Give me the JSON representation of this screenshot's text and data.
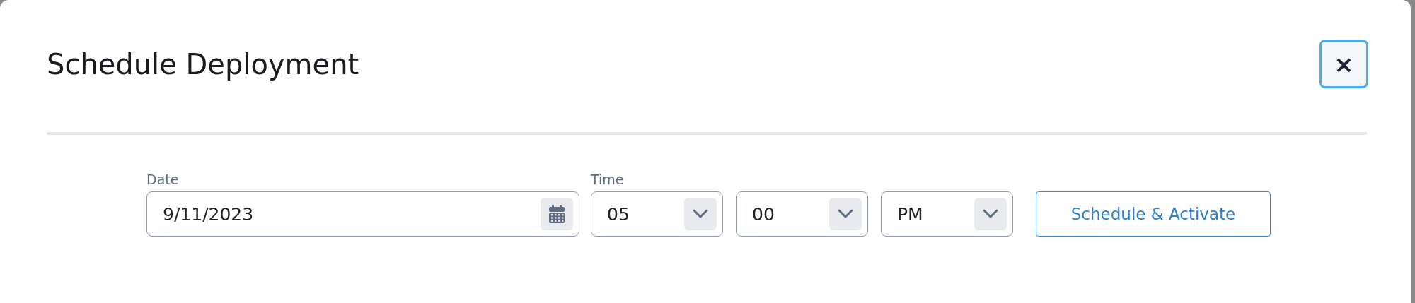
{
  "dialog": {
    "title": "Schedule Deployment",
    "close_button": {
      "label": "×",
      "focused": true
    }
  },
  "form": {
    "date": {
      "label": "Date",
      "value": "9/11/2023"
    },
    "time": {
      "label": "Time",
      "selects": [
        {
          "value": "05"
        },
        {
          "value": "00"
        },
        {
          "value": "PM"
        }
      ]
    },
    "submit_button": {
      "label": "Schedule & Activate"
    }
  }
}
